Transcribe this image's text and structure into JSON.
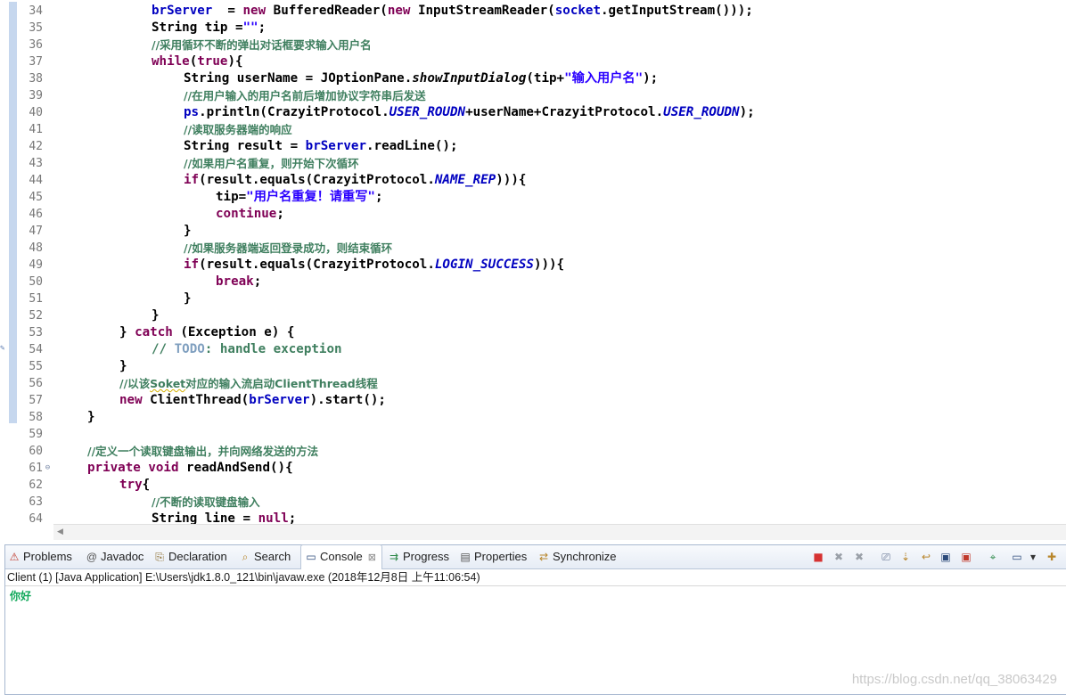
{
  "editor": {
    "lines": [
      {
        "n": "34",
        "ind": 3,
        "t": [
          [
            "fld",
            "brServer"
          ],
          [
            "",
            "  = "
          ],
          [
            "kw",
            "new"
          ],
          [
            "",
            " BufferedReader("
          ],
          [
            "kw",
            "new"
          ],
          [
            "",
            " InputStreamReader("
          ],
          [
            "fld",
            "socket"
          ],
          [
            "",
            ".getInputStream()));"
          ]
        ]
      },
      {
        "n": "35",
        "ind": 3,
        "t": [
          [
            "",
            "String tip ="
          ],
          [
            "str",
            "\"\""
          ],
          [
            "",
            ";"
          ]
        ]
      },
      {
        "n": "36",
        "ind": 3,
        "t": [
          [
            "cm",
            "//采用循环不断的弹出对话框要求输入用户名"
          ]
        ]
      },
      {
        "n": "37",
        "ind": 3,
        "t": [
          [
            "kw",
            "while"
          ],
          [
            "",
            "("
          ],
          [
            "kw",
            "true"
          ],
          [
            "",
            "){"
          ]
        ]
      },
      {
        "n": "38",
        "ind": 4,
        "t": [
          [
            "",
            "String userName = JOptionPane."
          ],
          [
            "mi",
            "showInputDialog"
          ],
          [
            "",
            "(tip+"
          ],
          [
            "str",
            "\"输入用户名\""
          ],
          [
            "",
            ");"
          ]
        ]
      },
      {
        "n": "39",
        "ind": 4,
        "t": [
          [
            "cm",
            "//在用户输入的用户名前后增加协议字符串后发送"
          ]
        ]
      },
      {
        "n": "40",
        "ind": 4,
        "t": [
          [
            "fld",
            "ps"
          ],
          [
            "",
            ".println(CrazyitProtocol."
          ],
          [
            "cn",
            "USER_ROUDN"
          ],
          [
            "",
            "+userName+CrazyitProtocol."
          ],
          [
            "cn",
            "USER_ROUDN"
          ],
          [
            "",
            ");"
          ]
        ]
      },
      {
        "n": "41",
        "ind": 4,
        "t": [
          [
            "cm",
            "//读取服务器端的响应"
          ]
        ]
      },
      {
        "n": "42",
        "ind": 4,
        "t": [
          [
            "",
            "String result = "
          ],
          [
            "fld",
            "brServer"
          ],
          [
            "",
            ".readLine();"
          ]
        ]
      },
      {
        "n": "43",
        "ind": 4,
        "t": [
          [
            "cm",
            "//如果用户名重复，则开始下次循环"
          ]
        ]
      },
      {
        "n": "44",
        "ind": 4,
        "t": [
          [
            "kw",
            "if"
          ],
          [
            "",
            "(result.equals(CrazyitProtocol."
          ],
          [
            "cn",
            "NAME_REP"
          ],
          [
            "",
            "))){"
          ]
        ]
      },
      {
        "n": "45",
        "ind": 5,
        "t": [
          [
            "",
            "tip="
          ],
          [
            "str",
            "\"用户名重复！请重写\""
          ],
          [
            "",
            ";"
          ]
        ]
      },
      {
        "n": "46",
        "ind": 5,
        "t": [
          [
            "kw",
            "continue"
          ],
          [
            "",
            ";"
          ]
        ]
      },
      {
        "n": "47",
        "ind": 4,
        "t": [
          [
            "",
            "}"
          ]
        ]
      },
      {
        "n": "48",
        "ind": 4,
        "t": [
          [
            "cm",
            "//如果服务器端返回登录成功，则结束循环"
          ]
        ]
      },
      {
        "n": "49",
        "ind": 4,
        "t": [
          [
            "kw",
            "if"
          ],
          [
            "",
            "(result.equals(CrazyitProtocol."
          ],
          [
            "cn",
            "LOGIN_SUCCESS"
          ],
          [
            "",
            "))){"
          ]
        ]
      },
      {
        "n": "50",
        "ind": 5,
        "t": [
          [
            "kw",
            "break"
          ],
          [
            "",
            ";"
          ]
        ]
      },
      {
        "n": "51",
        "ind": 4,
        "t": [
          [
            "",
            "}"
          ]
        ]
      },
      {
        "n": "52",
        "ind": 3,
        "t": [
          [
            "",
            "}"
          ]
        ]
      },
      {
        "n": "53",
        "ind": 2,
        "t": [
          [
            "",
            "} "
          ],
          [
            "kw",
            "catch"
          ],
          [
            "",
            " (Exception e) {"
          ]
        ]
      },
      {
        "n": "54",
        "ind": 3,
        "t": [
          [
            "cmm",
            "// "
          ],
          [
            "td",
            "TODO"
          ],
          [
            "cmm",
            ": handle exception"
          ]
        ]
      },
      {
        "n": "55",
        "ind": 2,
        "t": [
          [
            "",
            "}"
          ]
        ]
      },
      {
        "n": "56",
        "ind": 2,
        "t": [
          [
            "cm",
            "//以该"
          ],
          [
            "cmsq",
            "Soket"
          ],
          [
            "cm",
            "对应的输入流启动ClientThread线程"
          ]
        ]
      },
      {
        "n": "57",
        "ind": 2,
        "t": [
          [
            "kw",
            "new"
          ],
          [
            "",
            " ClientThread("
          ],
          [
            "fld",
            "brServer"
          ],
          [
            "",
            ").start();"
          ]
        ]
      },
      {
        "n": "58",
        "ind": 1,
        "t": [
          [
            "",
            "}"
          ]
        ]
      },
      {
        "n": "59",
        "ind": 0,
        "t": []
      },
      {
        "n": "60",
        "ind": 1,
        "t": [
          [
            "cm",
            "//定义一个读取键盘输出，并向网络发送的方法"
          ]
        ]
      },
      {
        "n": "61",
        "ind": 1,
        "t": [
          [
            "kw",
            "private"
          ],
          [
            "",
            ""
          ],
          [
            "kw",
            " void"
          ],
          [
            "",
            " readAndSend(){"
          ]
        ]
      },
      {
        "n": "62",
        "ind": 2,
        "t": [
          [
            "kw",
            "try"
          ],
          [
            "",
            "{"
          ]
        ]
      },
      {
        "n": "63",
        "ind": 3,
        "t": [
          [
            "cm",
            "//不断的读取键盘输入"
          ]
        ]
      },
      {
        "n": "64",
        "ind": 3,
        "t": [
          [
            "",
            "String line = "
          ],
          [
            "kw",
            "null"
          ],
          [
            "",
            ";"
          ]
        ]
      }
    ]
  },
  "console": {
    "tabs": [
      {
        "label": "Problems",
        "icon": "problems-icon"
      },
      {
        "label": "Javadoc",
        "icon": "javadoc-icon"
      },
      {
        "label": "Declaration",
        "icon": "declaration-icon"
      },
      {
        "label": "Search",
        "icon": "search-icon"
      },
      {
        "label": "Console",
        "icon": "console-icon",
        "active": true
      },
      {
        "label": "Progress",
        "icon": "progress-icon"
      },
      {
        "label": "Properties",
        "icon": "properties-icon"
      },
      {
        "label": "Synchronize",
        "icon": "synchronize-icon"
      }
    ],
    "close_glyph": "⊠",
    "launch_label": "Client (1) [Java Application] E:\\Users\\jdk1.8.0_121\\bin\\javaw.exe (2018年12月8日 上午11:06:54)",
    "output": "你好"
  },
  "watermark": "https://blog.csdn.net/qq_38063429",
  "colors": {
    "keyword": "#7f0055",
    "field": "#0000c0",
    "string": "#2a00ff",
    "comment": "#3f7f5f",
    "output": "#11a85a"
  }
}
